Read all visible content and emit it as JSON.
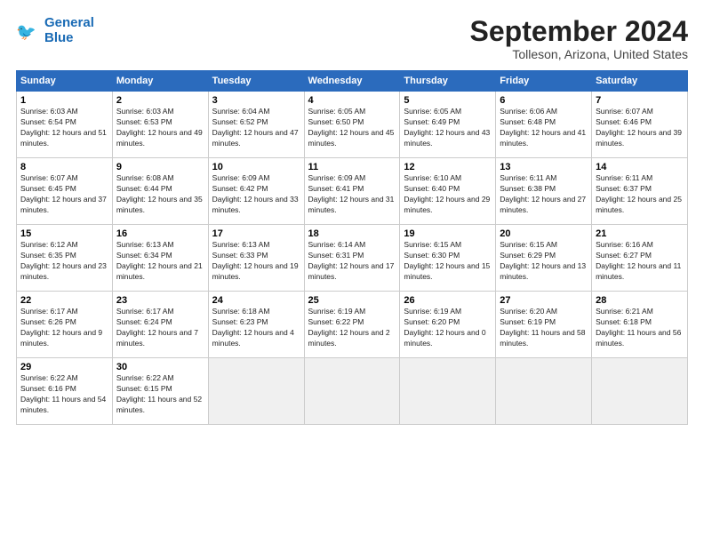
{
  "logo": {
    "line1": "General",
    "line2": "Blue"
  },
  "title": "September 2024",
  "location": "Tolleson, Arizona, United States",
  "headers": [
    "Sunday",
    "Monday",
    "Tuesday",
    "Wednesday",
    "Thursday",
    "Friday",
    "Saturday"
  ],
  "weeks": [
    [
      {
        "day": "1",
        "sunrise": "6:03 AM",
        "sunset": "6:54 PM",
        "daylight": "12 hours and 51 minutes."
      },
      {
        "day": "2",
        "sunrise": "6:03 AM",
        "sunset": "6:53 PM",
        "daylight": "12 hours and 49 minutes."
      },
      {
        "day": "3",
        "sunrise": "6:04 AM",
        "sunset": "6:52 PM",
        "daylight": "12 hours and 47 minutes."
      },
      {
        "day": "4",
        "sunrise": "6:05 AM",
        "sunset": "6:50 PM",
        "daylight": "12 hours and 45 minutes."
      },
      {
        "day": "5",
        "sunrise": "6:05 AM",
        "sunset": "6:49 PM",
        "daylight": "12 hours and 43 minutes."
      },
      {
        "day": "6",
        "sunrise": "6:06 AM",
        "sunset": "6:48 PM",
        "daylight": "12 hours and 41 minutes."
      },
      {
        "day": "7",
        "sunrise": "6:07 AM",
        "sunset": "6:46 PM",
        "daylight": "12 hours and 39 minutes."
      }
    ],
    [
      {
        "day": "8",
        "sunrise": "6:07 AM",
        "sunset": "6:45 PM",
        "daylight": "12 hours and 37 minutes."
      },
      {
        "day": "9",
        "sunrise": "6:08 AM",
        "sunset": "6:44 PM",
        "daylight": "12 hours and 35 minutes."
      },
      {
        "day": "10",
        "sunrise": "6:09 AM",
        "sunset": "6:42 PM",
        "daylight": "12 hours and 33 minutes."
      },
      {
        "day": "11",
        "sunrise": "6:09 AM",
        "sunset": "6:41 PM",
        "daylight": "12 hours and 31 minutes."
      },
      {
        "day": "12",
        "sunrise": "6:10 AM",
        "sunset": "6:40 PM",
        "daylight": "12 hours and 29 minutes."
      },
      {
        "day": "13",
        "sunrise": "6:11 AM",
        "sunset": "6:38 PM",
        "daylight": "12 hours and 27 minutes."
      },
      {
        "day": "14",
        "sunrise": "6:11 AM",
        "sunset": "6:37 PM",
        "daylight": "12 hours and 25 minutes."
      }
    ],
    [
      {
        "day": "15",
        "sunrise": "6:12 AM",
        "sunset": "6:35 PM",
        "daylight": "12 hours and 23 minutes."
      },
      {
        "day": "16",
        "sunrise": "6:13 AM",
        "sunset": "6:34 PM",
        "daylight": "12 hours and 21 minutes."
      },
      {
        "day": "17",
        "sunrise": "6:13 AM",
        "sunset": "6:33 PM",
        "daylight": "12 hours and 19 minutes."
      },
      {
        "day": "18",
        "sunrise": "6:14 AM",
        "sunset": "6:31 PM",
        "daylight": "12 hours and 17 minutes."
      },
      {
        "day": "19",
        "sunrise": "6:15 AM",
        "sunset": "6:30 PM",
        "daylight": "12 hours and 15 minutes."
      },
      {
        "day": "20",
        "sunrise": "6:15 AM",
        "sunset": "6:29 PM",
        "daylight": "12 hours and 13 minutes."
      },
      {
        "day": "21",
        "sunrise": "6:16 AM",
        "sunset": "6:27 PM",
        "daylight": "12 hours and 11 minutes."
      }
    ],
    [
      {
        "day": "22",
        "sunrise": "6:17 AM",
        "sunset": "6:26 PM",
        "daylight": "12 hours and 9 minutes."
      },
      {
        "day": "23",
        "sunrise": "6:17 AM",
        "sunset": "6:24 PM",
        "daylight": "12 hours and 7 minutes."
      },
      {
        "day": "24",
        "sunrise": "6:18 AM",
        "sunset": "6:23 PM",
        "daylight": "12 hours and 4 minutes."
      },
      {
        "day": "25",
        "sunrise": "6:19 AM",
        "sunset": "6:22 PM",
        "daylight": "12 hours and 2 minutes."
      },
      {
        "day": "26",
        "sunrise": "6:19 AM",
        "sunset": "6:20 PM",
        "daylight": "12 hours and 0 minutes."
      },
      {
        "day": "27",
        "sunrise": "6:20 AM",
        "sunset": "6:19 PM",
        "daylight": "11 hours and 58 minutes."
      },
      {
        "day": "28",
        "sunrise": "6:21 AM",
        "sunset": "6:18 PM",
        "daylight": "11 hours and 56 minutes."
      }
    ],
    [
      {
        "day": "29",
        "sunrise": "6:22 AM",
        "sunset": "6:16 PM",
        "daylight": "11 hours and 54 minutes."
      },
      {
        "day": "30",
        "sunrise": "6:22 AM",
        "sunset": "6:15 PM",
        "daylight": "11 hours and 52 minutes."
      },
      null,
      null,
      null,
      null,
      null
    ]
  ]
}
